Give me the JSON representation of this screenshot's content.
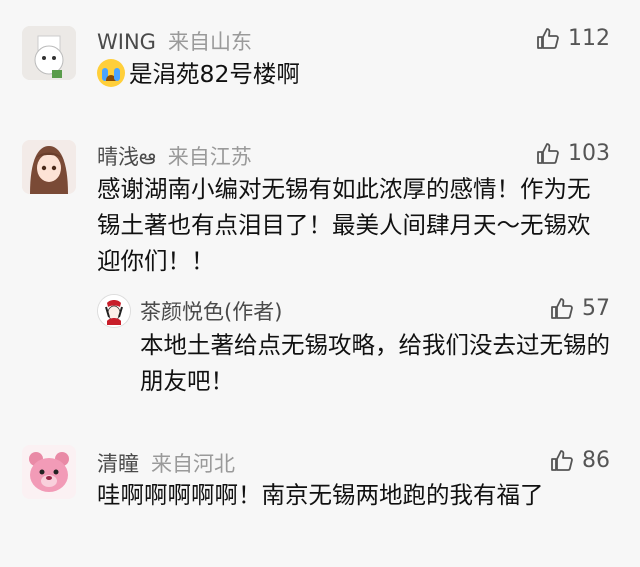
{
  "comments": [
    {
      "name": "WING",
      "location": "来自山东",
      "likes": "112",
      "text": "是涓苑82号楼啊",
      "emoji": "crying-emoji"
    },
    {
      "name": "晴浅ఆ",
      "location": "来自江苏",
      "likes": "103",
      "text": "感谢湖南小编对无锡有如此浓厚的感情！作为无锡土著也有点泪目了！最美人间肆月天～无锡欢迎你们！！",
      "reply": {
        "name": "茶颜悦色(作者)",
        "likes": "57",
        "text": "本地土著给点无锡攻略，给我们没去过无锡的朋友吧！"
      }
    },
    {
      "name": "清瞳",
      "location": "来自河北",
      "likes": "86",
      "text": "哇啊啊啊啊啊！南京无锡两地跑的我有福了"
    }
  ],
  "colors": {
    "background": "#f7f7f7",
    "name": "#4a4a4a",
    "meta": "#9a9a9a",
    "text": "#111111"
  }
}
